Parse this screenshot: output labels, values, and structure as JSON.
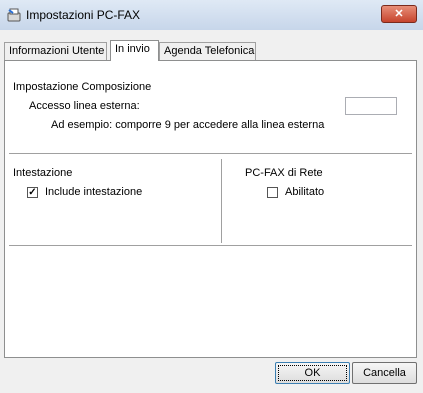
{
  "window": {
    "title": "Impostazioni PC-FAX",
    "close_glyph": "✕"
  },
  "tabs": [
    {
      "label": "Informazioni Utente",
      "active": false
    },
    {
      "label": "In invio",
      "active": true
    },
    {
      "label": "Agenda Telefonica",
      "active": false
    }
  ],
  "dialing": {
    "section_title": "Impostazione Composizione",
    "outside_line_label": "Accesso linea esterna:",
    "outside_line_value": "",
    "example_text": "Ad esempio: comporre 9 per accedere alla linea esterna"
  },
  "header": {
    "section_title": "Intestazione",
    "checkbox_label": "Include intestazione",
    "checked": true
  },
  "network": {
    "section_title": "PC-FAX di Rete",
    "checkbox_label": "Abilitato",
    "checked": false
  },
  "buttons": {
    "ok": "OK",
    "cancel": "Cancella"
  },
  "colors": {
    "titlebar": "#c7d6ea",
    "close": "#c6442d",
    "dialog_bg": "#f0f0f0"
  },
  "icons": {
    "app": "fax-icon",
    "close": "close-icon",
    "check": "checkmark-icon"
  }
}
